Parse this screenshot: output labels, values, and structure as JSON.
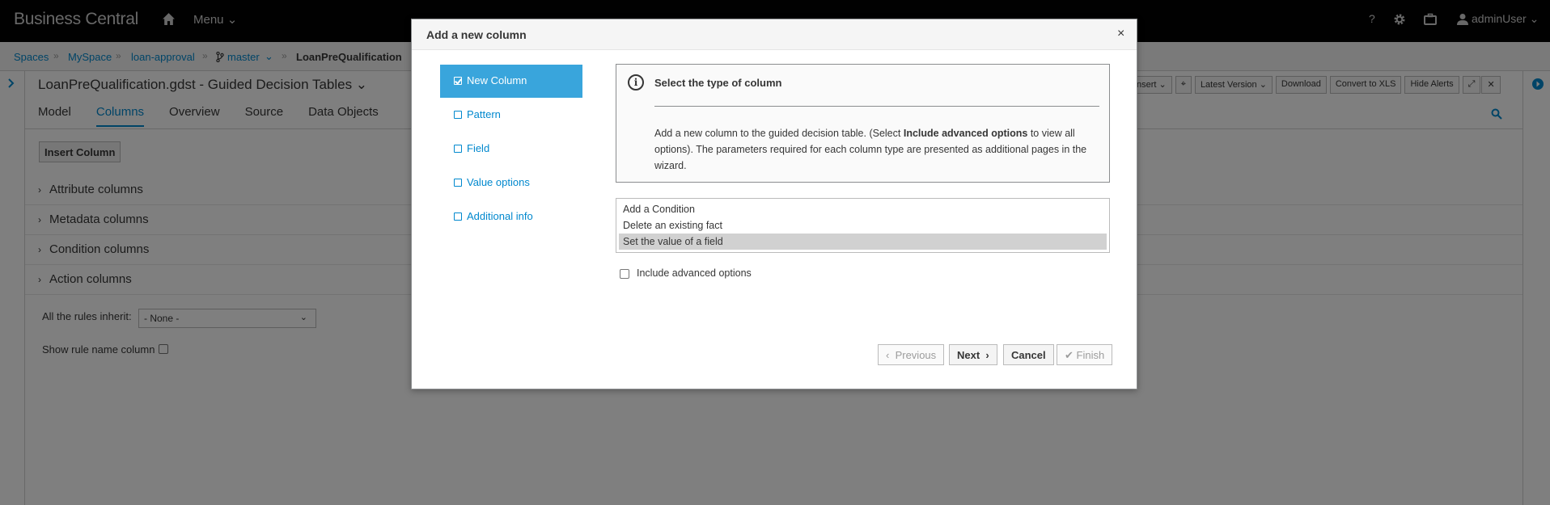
{
  "topnav": {
    "brand": "Business Central",
    "menu_label": "Menu ⌄",
    "help_label": "?",
    "user_label": "adminUser ⌄"
  },
  "breadcrumb": {
    "items": [
      "Spaces",
      "MySpace",
      "loan-approval",
      "master",
      "LoanPreQualification"
    ]
  },
  "editor": {
    "title": "LoanPreQualification.gdst - Guided Decision Tables ⌄",
    "toolbar": [
      "nsert ⌄",
      "⌖",
      "Latest Version ⌄",
      "Download",
      "Convert to XLS",
      "Hide Alerts",
      "⤢",
      "✕"
    ],
    "tabs": [
      "Model",
      "Columns",
      "Overview",
      "Source",
      "Data Objects"
    ],
    "active_tab": "Columns",
    "insert_button": "Insert Column",
    "sections": [
      "Attribute columns",
      "Metadata columns",
      "Condition columns",
      "Action columns"
    ],
    "inherit_label": "All the rules inherit:",
    "inherit_value": "- None -",
    "show_rule_name_label": "Show rule name column"
  },
  "modal": {
    "title": "Add a new column",
    "close_label": "×",
    "steps": [
      "New Column",
      "Pattern",
      "Field",
      "Value options",
      "Additional info"
    ],
    "active_step": "New Column",
    "info": {
      "heading": "Select the type of column",
      "body_pre": "Add a new column to the guided decision table. (Select ",
      "body_bold": "Include advanced options",
      "body_post": " to view all options). The parameters required for each column type are presented as additional pages in the wizard."
    },
    "column_types": [
      "Add a Condition",
      "Delete an existing fact",
      "Set the value of a field"
    ],
    "selected_type": "Set the value of a field",
    "advanced_label": "Include advanced options",
    "buttons": {
      "previous": "Previous",
      "next": "Next",
      "cancel": "Cancel",
      "finish": "Finish"
    }
  }
}
